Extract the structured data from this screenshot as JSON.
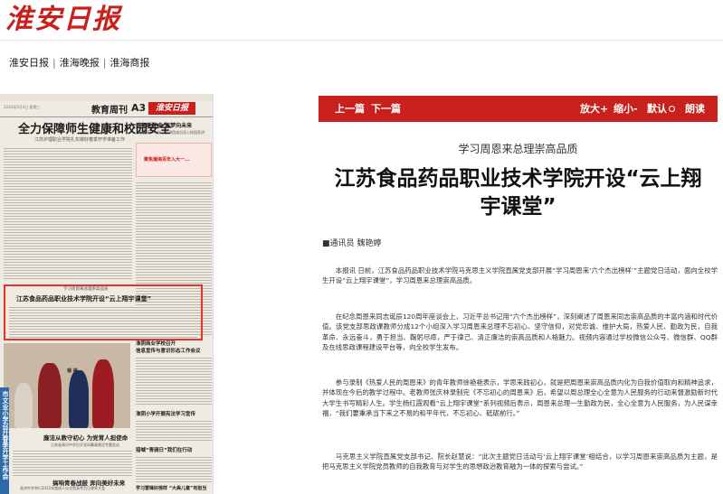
{
  "site": {
    "logo_text": "淮安日报"
  },
  "topnav": {
    "items": [
      "淮安日报",
      "淮海晚报",
      "淮海商报"
    ],
    "separator": "|"
  },
  "paper": {
    "header_meta": "2022年5月4日 星期三",
    "section": "教育周刊",
    "page_no": "A3",
    "mini_logo": "淮安日报",
    "headline": "全力保障师生健康和校园安全",
    "subhead": "江苏护理职业学院扎实做好春季开学准备工作",
    "right_top_title": "共担新使命 逐梦向未来",
    "right_top_sub": "市全国青少年学习宣讲团成员深入校园宣讲",
    "banner_text": "聚焦瀚海百年入大一...",
    "highlight_kicker": "学习周恩来总理崇高品质",
    "highlight_title": "江苏食品药品职业技术学院开设“云上翔宇课堂”",
    "col_title_1": "淮阴商业学校召开",
    "col_title_1b": "信息宣传与意识形态工作会议",
    "col_title_2": "淮阴小学开展宪法学习宣传",
    "col_title_3": "廉洁从教守初心 为党育人担使命",
    "col_title_3_sub": "江苏省清河中学召开党风廉政建设专题会议",
    "col_title_4": "猎喊“青骑日”我们在行动",
    "col_title_5": "学习雷锋好榜样 “大美儿童”有担当",
    "col_title_6": "搞响青春战鼓 奔向美好未来",
    "col_title_6_sub": "淮洪中学举行2022年度成人仪式暨高考百日誓师大会",
    "col_title_7": "新区幼儿园召开",
    "col_title_7b": "新学期线上家长会",
    "vertical_banner": "市文业小学召开春季开学工作会"
  },
  "toolbar": {
    "prev": "上一篇",
    "next": "下一篇",
    "zoom_in": "放大+",
    "zoom_out": "缩小-",
    "default": "默认",
    "read_aloud": "朗读"
  },
  "article": {
    "kicker": "学习周恩来总理崇高品质",
    "title": "江苏食品药品职业技术学院开设“云上翔宇课堂”",
    "byline": "■通讯员 魏艳婷",
    "paragraphs": [
      "本报讯 日前，江苏食品药品职业技术学院马克思主义学院直属党支部开展“学习周恩来‘六个杰出榜样’”主题党日活动，面向全校学生开设“云上翔宇课堂”，学习周恩来总理崇高品质。",
      "在纪念周恩来同志诞辰120周年座谈会上，习近平总书记用“六个杰出榜样”，深刻阐述了周恩来同志崇高品质的丰富内涵和时代价值。该党支部思政课教师分成12个小组深入学习周恩来总理不忘初心、坚守信仰，对党忠诚、维护大局，热爱人民、勤政为民，自我革命、永远奋斗，勇于担当、鞠躬尽瘁，严于律己、清正廉洁的崇高品质和人格魅力。视频内容通过学校微信公众号、微信群、QQ群及在线思政课程建设平台等，向全校学生发布。",
      "参与录制《热爱人民的周恩来》的青年教师徐艳艳表示，学思来践初心，就是把周恩来崇高品质内化为自我价值取向和精神追求，并体现在今后的教学过程中。老教师张庆林录制完《不忘初心的周恩来》后，希望以周总理全心全意为人民服务的行动来督激励新时代大学生书写精彩人生。学生杨红霞观看“云上翔宇课堂”系列视频后表示，周恩来总理一生勤政为民，全心全意为人民服务，为人民谋幸福，“我们要秉承当下来之不易的和平年代，不忘初心、砥砺前行。”",
      "马克思主义学院直属党支部书记、院长赵慧说：“此次主题党日活动与‘云上翔宇课堂’相结合，以学习周恩来崇高品质为主题，是把马克思主义学院党员教师的自我教育与对学生的思想政治教育融为一体的探索与尝试。”"
    ]
  },
  "colors": {
    "accent": "#c8201d",
    "highlight_box": "#e6332a",
    "paper_bg": "#efebe2"
  }
}
